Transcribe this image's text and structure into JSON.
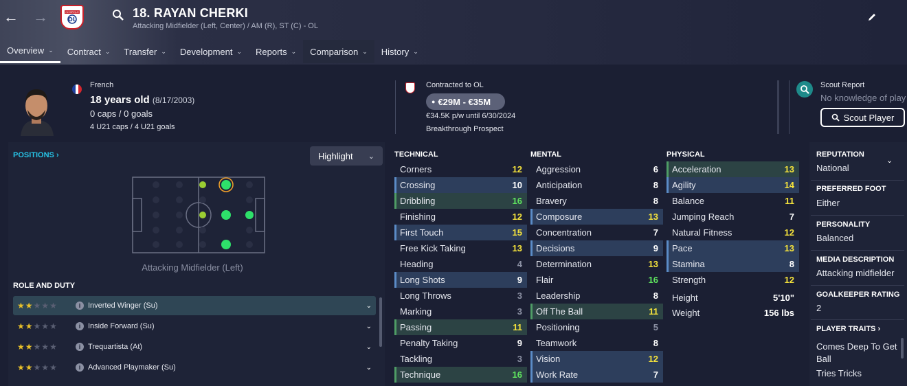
{
  "header": {
    "player_name": "18. RAYAN CHERKI",
    "subtitle": "Attacking Midfielder (Left, Center) / AM (R), ST (C) - OL",
    "club_crest_text": "OLYMPIQUE LYONNAIS",
    "tabs": [
      {
        "label": "Overview"
      },
      {
        "label": "Contract"
      },
      {
        "label": "Transfer"
      },
      {
        "label": "Development"
      },
      {
        "label": "Reports"
      },
      {
        "label": "Comparison"
      },
      {
        "label": "History"
      }
    ]
  },
  "profile": {
    "nationality": "French",
    "age": "18 years old",
    "dob": "(8/17/2003)",
    "caps": "0 caps / 0 goals",
    "u21": "4 U21 caps / 4 U21 goals"
  },
  "contract": {
    "status": "Contracted to OL",
    "value": "€29M - €35M",
    "wage": "€34.5K p/w until 6/30/2024",
    "tag": "Breakthrough Prospect"
  },
  "scout": {
    "label": "Scout Report",
    "knowledge": "No knowledge of play",
    "button": "Scout Player"
  },
  "positions": {
    "label": "POSITIONS",
    "highlight": "Highlight",
    "caption": "Attacking Midfielder (Left)"
  },
  "roles": {
    "label": "ROLE AND DUTY",
    "items": [
      {
        "name": "Inverted Winger (Su)",
        "stars": 2
      },
      {
        "name": "Inside Forward (Su)",
        "stars": 2
      },
      {
        "name": "Trequartista (At)",
        "stars": 2
      },
      {
        "name": "Advanced Playmaker (Su)",
        "stars": 2
      }
    ]
  },
  "attributes": {
    "technical": {
      "label": "TECHNICAL",
      "items": [
        {
          "name": "Corners",
          "value": "12",
          "hl": ""
        },
        {
          "name": "Crossing",
          "value": "10",
          "hl": "blue"
        },
        {
          "name": "Dribbling",
          "value": "16",
          "hl": "green"
        },
        {
          "name": "Finishing",
          "value": "12",
          "hl": ""
        },
        {
          "name": "First Touch",
          "value": "15",
          "hl": "blue"
        },
        {
          "name": "Free Kick Taking",
          "value": "13",
          "hl": ""
        },
        {
          "name": "Heading",
          "value": "4",
          "hl": ""
        },
        {
          "name": "Long Shots",
          "value": "9",
          "hl": "blue"
        },
        {
          "name": "Long Throws",
          "value": "3",
          "hl": ""
        },
        {
          "name": "Marking",
          "value": "3",
          "hl": ""
        },
        {
          "name": "Passing",
          "value": "11",
          "hl": "green"
        },
        {
          "name": "Penalty Taking",
          "value": "9",
          "hl": ""
        },
        {
          "name": "Tackling",
          "value": "3",
          "hl": ""
        },
        {
          "name": "Technique",
          "value": "16",
          "hl": "green"
        }
      ]
    },
    "mental": {
      "label": "MENTAL",
      "items": [
        {
          "name": "Aggression",
          "value": "6",
          "hl": ""
        },
        {
          "name": "Anticipation",
          "value": "8",
          "hl": ""
        },
        {
          "name": "Bravery",
          "value": "8",
          "hl": ""
        },
        {
          "name": "Composure",
          "value": "13",
          "hl": "blue"
        },
        {
          "name": "Concentration",
          "value": "7",
          "hl": ""
        },
        {
          "name": "Decisions",
          "value": "9",
          "hl": "blue"
        },
        {
          "name": "Determination",
          "value": "13",
          "hl": ""
        },
        {
          "name": "Flair",
          "value": "16",
          "hl": ""
        },
        {
          "name": "Leadership",
          "value": "8",
          "hl": ""
        },
        {
          "name": "Off The Ball",
          "value": "11",
          "hl": "green"
        },
        {
          "name": "Positioning",
          "value": "5",
          "hl": ""
        },
        {
          "name": "Teamwork",
          "value": "8",
          "hl": ""
        },
        {
          "name": "Vision",
          "value": "12",
          "hl": "blue"
        },
        {
          "name": "Work Rate",
          "value": "7",
          "hl": "blue"
        }
      ]
    },
    "physical": {
      "label": "PHYSICAL",
      "items": [
        {
          "name": "Acceleration",
          "value": "13",
          "hl": "green"
        },
        {
          "name": "Agility",
          "value": "14",
          "hl": "blue"
        },
        {
          "name": "Balance",
          "value": "11",
          "hl": ""
        },
        {
          "name": "Jumping Reach",
          "value": "7",
          "hl": ""
        },
        {
          "name": "Natural Fitness",
          "value": "12",
          "hl": ""
        },
        {
          "name": "Pace",
          "value": "13",
          "hl": "blue"
        },
        {
          "name": "Stamina",
          "value": "8",
          "hl": "blue"
        },
        {
          "name": "Strength",
          "value": "12",
          "hl": ""
        }
      ],
      "height_label": "Height",
      "height": "5'10\"",
      "weight_label": "Weight",
      "weight": "156 lbs"
    }
  },
  "sidebar": {
    "reputation_label": "REPUTATION",
    "reputation": "National",
    "foot_label": "PREFERRED FOOT",
    "foot": "Either",
    "personality_label": "PERSONALITY",
    "personality": "Balanced",
    "media_label": "MEDIA DESCRIPTION",
    "media": "Attacking midfielder",
    "gk_label": "GOALKEEPER RATING",
    "gk": "2",
    "traits_label": "PLAYER TRAITS",
    "traits": [
      "Comes Deep To Get Ball",
      "Tries Tricks"
    ]
  },
  "colors": {
    "accent": "#27c3e6",
    "star": "#e8c02a",
    "green_val": "#5fe55f",
    "yellow_val": "#f4e23c",
    "pos_natural": "#2ee06a",
    "pos_competent": "#9acd32"
  }
}
